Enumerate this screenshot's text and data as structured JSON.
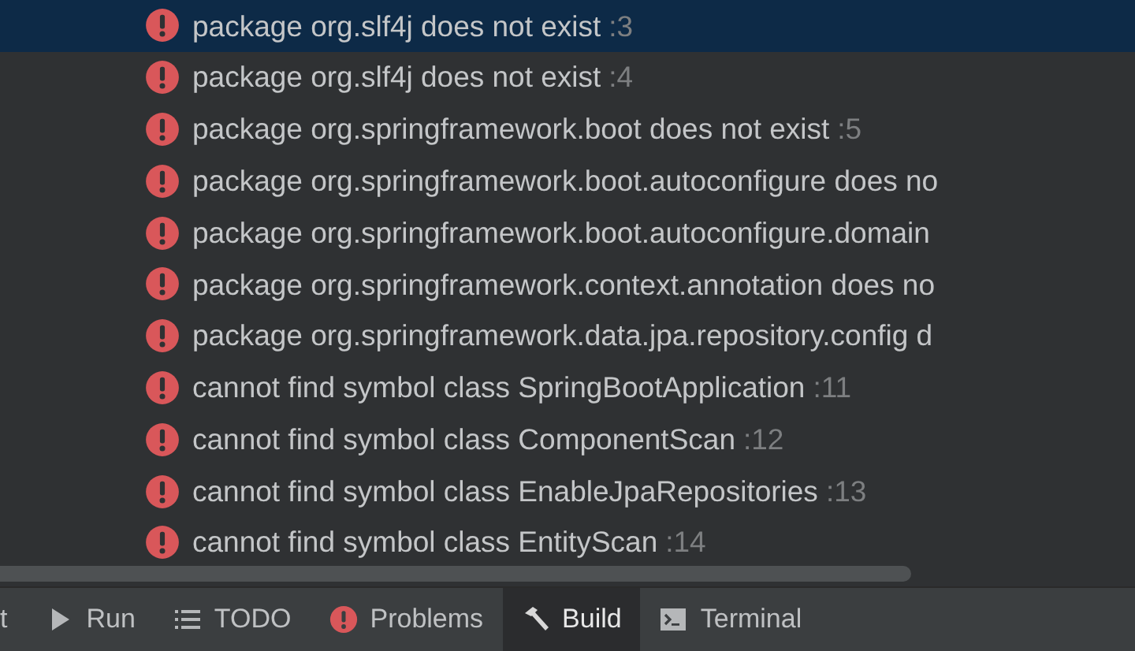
{
  "messages": [
    {
      "kind": "error",
      "text": "package org.slf4j does not exist",
      "line": ":3",
      "selected": true
    },
    {
      "kind": "error",
      "text": "package org.slf4j does not exist",
      "line": ":4",
      "selected": false
    },
    {
      "kind": "error",
      "text": "package org.springframework.boot does not exist",
      "line": ":5",
      "selected": false
    },
    {
      "kind": "error",
      "text": "package org.springframework.boot.autoconfigure does no",
      "selected": false
    },
    {
      "kind": "error",
      "text": "package org.springframework.boot.autoconfigure.domain",
      "selected": false
    },
    {
      "kind": "error",
      "text": "package org.springframework.context.annotation does no",
      "selected": false
    },
    {
      "kind": "error",
      "text": "package org.springframework.data.jpa.repository.config d",
      "selected": false
    },
    {
      "kind": "error",
      "text": "cannot find symbol class SpringBootApplication",
      "line": ":11",
      "selected": false
    },
    {
      "kind": "error",
      "text": "cannot find symbol class ComponentScan",
      "line": ":12",
      "selected": false
    },
    {
      "kind": "error",
      "text": "cannot find symbol class EnableJpaRepositories",
      "line": ":13",
      "selected": false
    },
    {
      "kind": "error",
      "text": "cannot find symbol class EntityScan",
      "line": ":14",
      "selected": false
    }
  ],
  "tool_tabs": [
    {
      "kind": "none",
      "label": "t",
      "selected": false
    },
    {
      "kind": "run",
      "label": "Run",
      "selected": false
    },
    {
      "kind": "todo",
      "label": "TODO",
      "selected": false
    },
    {
      "kind": "problems",
      "label": "Problems",
      "selected": false
    },
    {
      "kind": "build",
      "label": "Build",
      "selected": true
    },
    {
      "kind": "terminal",
      "label": "Terminal",
      "selected": false
    }
  ]
}
